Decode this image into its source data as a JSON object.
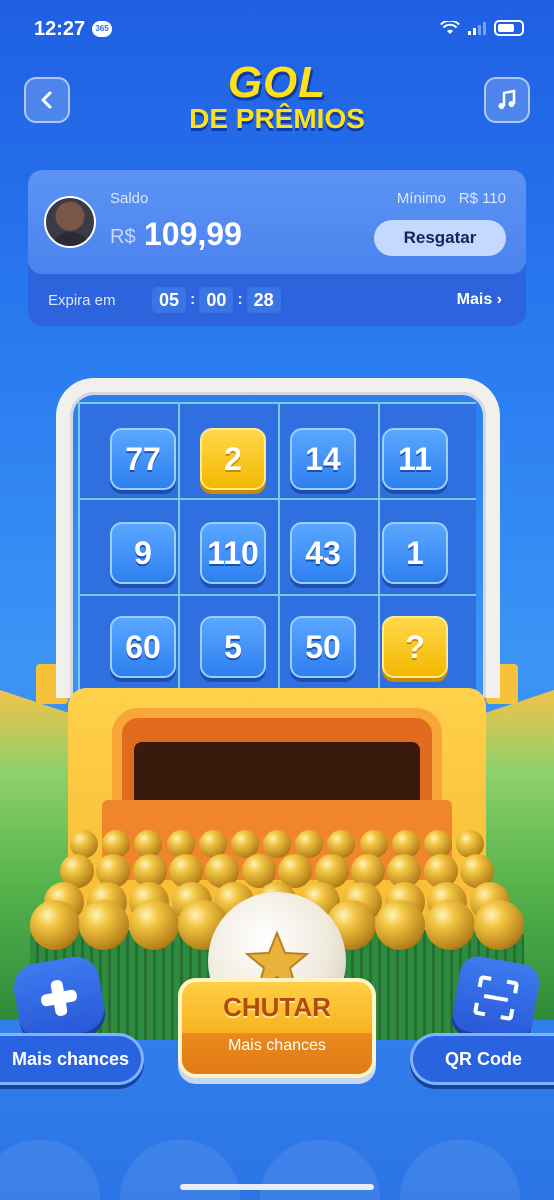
{
  "status_bar": {
    "time": "12:27",
    "badge": "365"
  },
  "header": {
    "title_line1": "GOL",
    "title_line2": "DE PRÊMIOS",
    "back_icon": "chevron-left-icon",
    "music_icon": "music-note-icon"
  },
  "balance": {
    "saldo_label": "Saldo",
    "currency": "R$",
    "amount": "109,99",
    "minimo_label": "Mínimo",
    "minimo_value": "R$ 110",
    "resgatar_label": "Resgatar",
    "expira_label": "Expira em",
    "timer": {
      "hours": "05",
      "minutes": "00",
      "seconds": "28"
    },
    "mais_label": "Mais ›"
  },
  "board": {
    "tiles": [
      "77",
      "2",
      "14",
      "11",
      "9",
      "110",
      "43",
      "1",
      "60",
      "5",
      "50",
      "?"
    ],
    "gold_tiles": [
      1,
      11
    ]
  },
  "controls": {
    "chutar_label": "CHUTAR",
    "chutar_sub": "Mais chances",
    "mais_chances_label": "Mais chances",
    "qr_label": "QR Code"
  },
  "colors": {
    "accent_yellow": "#ffe11a",
    "background_blue": "#2a7cf0",
    "gold_tile": "#f3b800"
  }
}
